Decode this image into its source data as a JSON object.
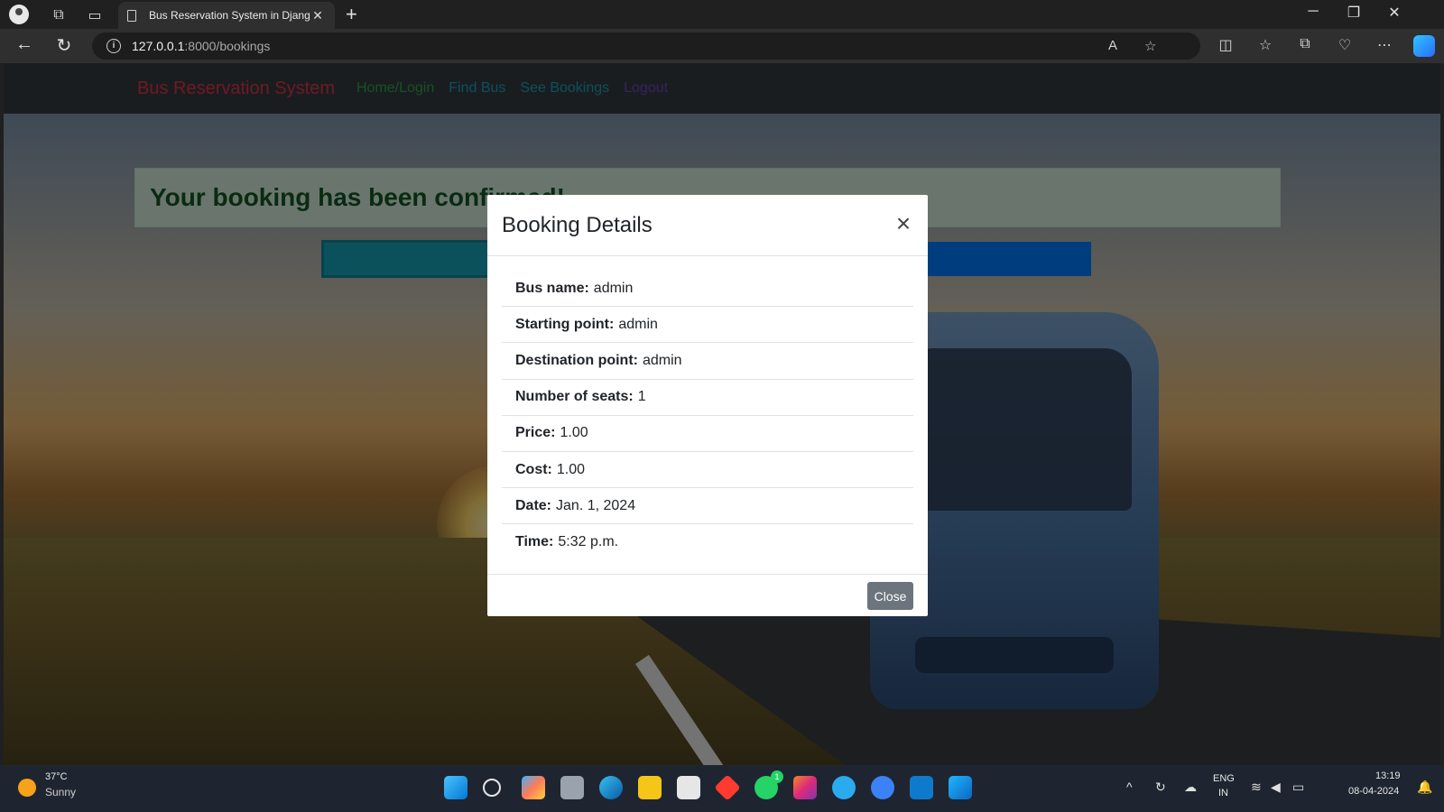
{
  "browser": {
    "tab_title": "Bus Reservation System in Djang",
    "tab_close": "✕",
    "new_tab": "+",
    "url_host": "127.0.0.1",
    "url_rest": ":8000/bookings",
    "win_minimize": "─",
    "win_restore": "❐",
    "win_close": "✕"
  },
  "site": {
    "brand": "Bus Reservation System",
    "nav": {
      "home": "Home/Login",
      "find": "Find Bus",
      "see": "See Bookings",
      "logout": "Logout"
    },
    "alert": "Your booking has been confirmed!"
  },
  "modal": {
    "title": "Booking Details",
    "close_x": "×",
    "close_button": "Close",
    "rows": [
      {
        "label": "Bus name:",
        "value": "admin"
      },
      {
        "label": "Starting point:",
        "value": "admin"
      },
      {
        "label": "Destination point:",
        "value": "admin"
      },
      {
        "label": "Number of seats:",
        "value": "1"
      },
      {
        "label": "Price:",
        "value": "1.00"
      },
      {
        "label": "Cost:",
        "value": "1.00"
      },
      {
        "label": "Date:",
        "value": "Jan. 1, 2024"
      },
      {
        "label": "Time:",
        "value": "5:32 p.m."
      }
    ]
  },
  "taskbar": {
    "temp": "37°C",
    "condition": "Sunny",
    "lang1": "ENG",
    "lang2": "IN",
    "time": "13:19",
    "date": "08-04-2024",
    "whatsapp_badge": "1"
  },
  "colors": {
    "brand": "#dc3545",
    "alert_bg": "#d4edda",
    "alert_text": "#155724",
    "close_btn": "#6c757d"
  }
}
